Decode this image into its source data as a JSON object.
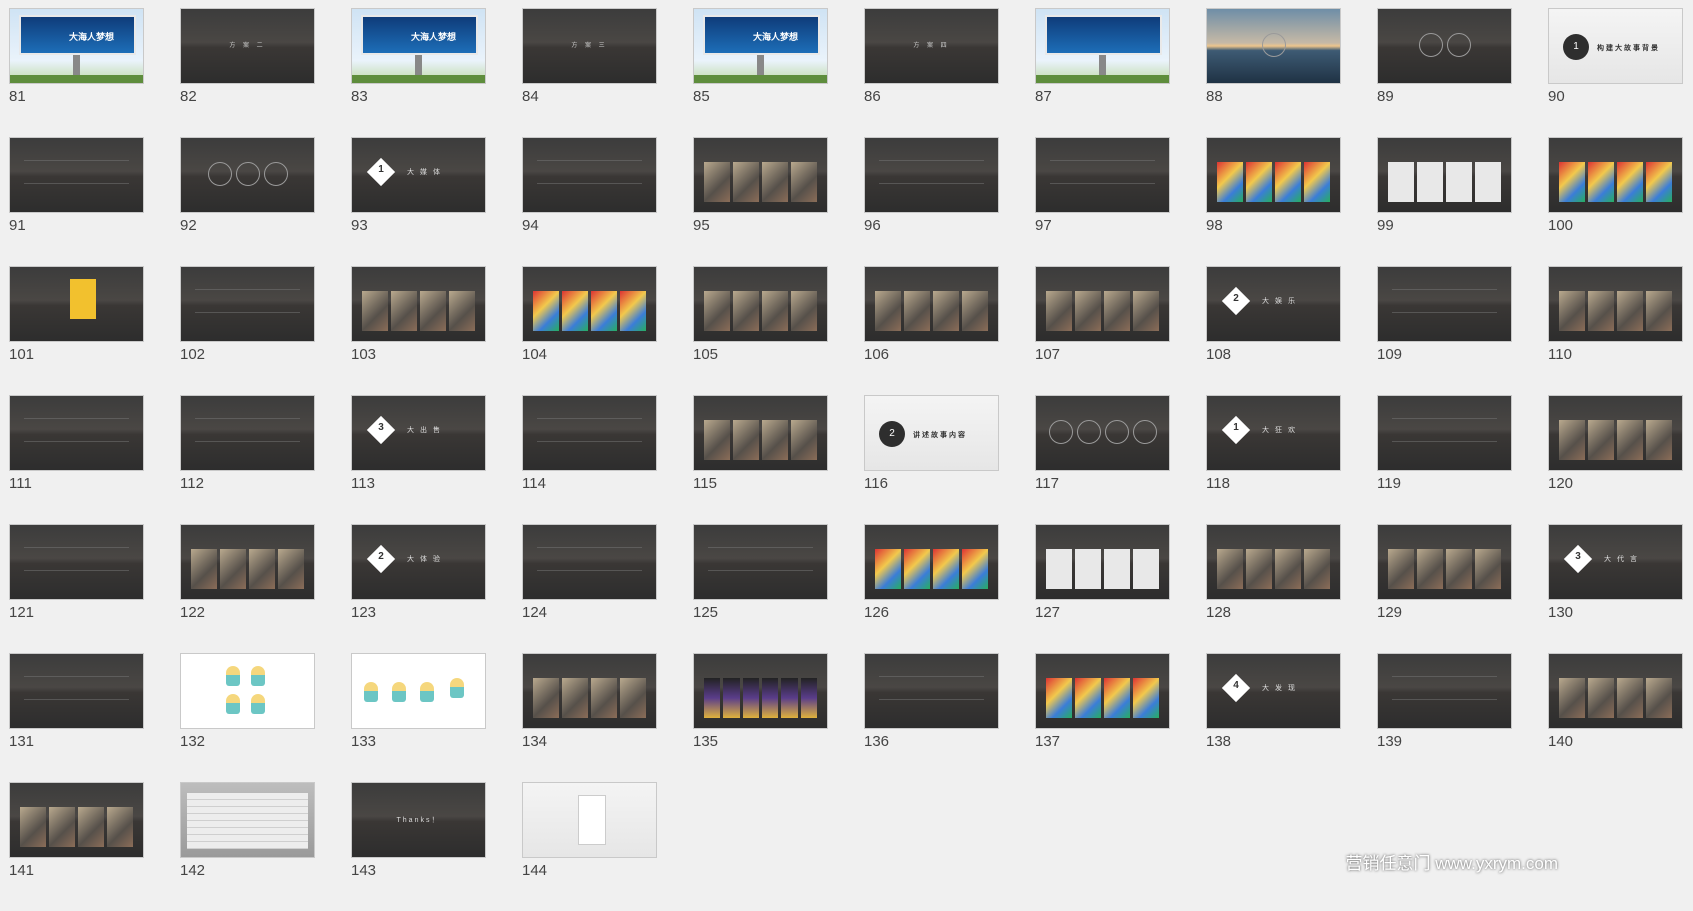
{
  "slides": [
    {
      "num": "81",
      "kind": "billboard",
      "title": "大海人梦想"
    },
    {
      "num": "82",
      "kind": "title",
      "title": "方 案 二"
    },
    {
      "num": "83",
      "kind": "billboard",
      "title": "大海人梦想"
    },
    {
      "num": "84",
      "kind": "title",
      "title": "方 案 三"
    },
    {
      "num": "85",
      "kind": "billboard",
      "title": "大海人梦想"
    },
    {
      "num": "86",
      "kind": "title",
      "title": "方 案 四"
    },
    {
      "num": "87",
      "kind": "billboard",
      "title": ""
    },
    {
      "num": "88",
      "kind": "sea",
      "title": ""
    },
    {
      "num": "89",
      "kind": "circles",
      "title": ""
    },
    {
      "num": "90",
      "kind": "badge",
      "badge": "1",
      "title": "构建大故事背景"
    },
    {
      "num": "91",
      "kind": "text",
      "title": ""
    },
    {
      "num": "92",
      "kind": "circles",
      "title": ""
    },
    {
      "num": "93",
      "kind": "diamond",
      "badge": "1",
      "title": "大媒体"
    },
    {
      "num": "94",
      "kind": "text",
      "title": ""
    },
    {
      "num": "95",
      "kind": "photos",
      "title": ""
    },
    {
      "num": "96",
      "kind": "text",
      "title": ""
    },
    {
      "num": "97",
      "kind": "text",
      "title": ""
    },
    {
      "num": "98",
      "kind": "colorphotos",
      "title": ""
    },
    {
      "num": "99",
      "kind": "cards",
      "title": ""
    },
    {
      "num": "100",
      "kind": "colorphotos",
      "title": ""
    },
    {
      "num": "101",
      "kind": "poster",
      "title": ""
    },
    {
      "num": "102",
      "kind": "text",
      "title": ""
    },
    {
      "num": "103",
      "kind": "photos",
      "title": ""
    },
    {
      "num": "104",
      "kind": "colorphotos",
      "title": ""
    },
    {
      "num": "105",
      "kind": "photos",
      "title": ""
    },
    {
      "num": "106",
      "kind": "photos",
      "title": ""
    },
    {
      "num": "107",
      "kind": "photos",
      "title": ""
    },
    {
      "num": "108",
      "kind": "diamond",
      "badge": "2",
      "title": "大娱乐"
    },
    {
      "num": "109",
      "kind": "text",
      "title": ""
    },
    {
      "num": "110",
      "kind": "photos",
      "title": ""
    },
    {
      "num": "111",
      "kind": "text",
      "title": ""
    },
    {
      "num": "112",
      "kind": "text",
      "title": ""
    },
    {
      "num": "113",
      "kind": "diamond",
      "badge": "3",
      "title": "大出售"
    },
    {
      "num": "114",
      "kind": "text",
      "title": ""
    },
    {
      "num": "115",
      "kind": "photos",
      "title": ""
    },
    {
      "num": "116",
      "kind": "badge",
      "badge": "2",
      "title": "讲述故事内容"
    },
    {
      "num": "117",
      "kind": "circles",
      "title": ""
    },
    {
      "num": "118",
      "kind": "diamond",
      "badge": "1",
      "title": "大狂欢"
    },
    {
      "num": "119",
      "kind": "text",
      "title": ""
    },
    {
      "num": "120",
      "kind": "photos",
      "title": ""
    },
    {
      "num": "121",
      "kind": "text",
      "title": ""
    },
    {
      "num": "122",
      "kind": "photos",
      "title": ""
    },
    {
      "num": "123",
      "kind": "diamond",
      "badge": "2",
      "title": "大体验"
    },
    {
      "num": "124",
      "kind": "text",
      "title": ""
    },
    {
      "num": "125",
      "kind": "text",
      "title": ""
    },
    {
      "num": "126",
      "kind": "colorphotos",
      "title": ""
    },
    {
      "num": "127",
      "kind": "cards",
      "title": ""
    },
    {
      "num": "128",
      "kind": "photos",
      "title": ""
    },
    {
      "num": "129",
      "kind": "photos",
      "title": ""
    },
    {
      "num": "130",
      "kind": "diamond",
      "badge": "3",
      "title": "大代言"
    },
    {
      "num": "131",
      "kind": "text",
      "title": ""
    },
    {
      "num": "132",
      "kind": "mermaid",
      "title": ""
    },
    {
      "num": "133",
      "kind": "mermaid",
      "title": ""
    },
    {
      "num": "134",
      "kind": "photos",
      "title": ""
    },
    {
      "num": "135",
      "kind": "phones",
      "title": ""
    },
    {
      "num": "136",
      "kind": "text",
      "title": ""
    },
    {
      "num": "137",
      "kind": "colorphotos",
      "title": ""
    },
    {
      "num": "138",
      "kind": "diamond",
      "badge": "4",
      "title": "大发现"
    },
    {
      "num": "139",
      "kind": "text",
      "title": ""
    },
    {
      "num": "140",
      "kind": "photos",
      "title": ""
    },
    {
      "num": "141",
      "kind": "photos",
      "title": ""
    },
    {
      "num": "142",
      "kind": "table",
      "title": ""
    },
    {
      "num": "143",
      "kind": "thanks",
      "title": "Thanks！"
    },
    {
      "num": "144",
      "kind": "document",
      "title": ""
    }
  ],
  "watermark": "营销任意门 www.yxrym.com"
}
